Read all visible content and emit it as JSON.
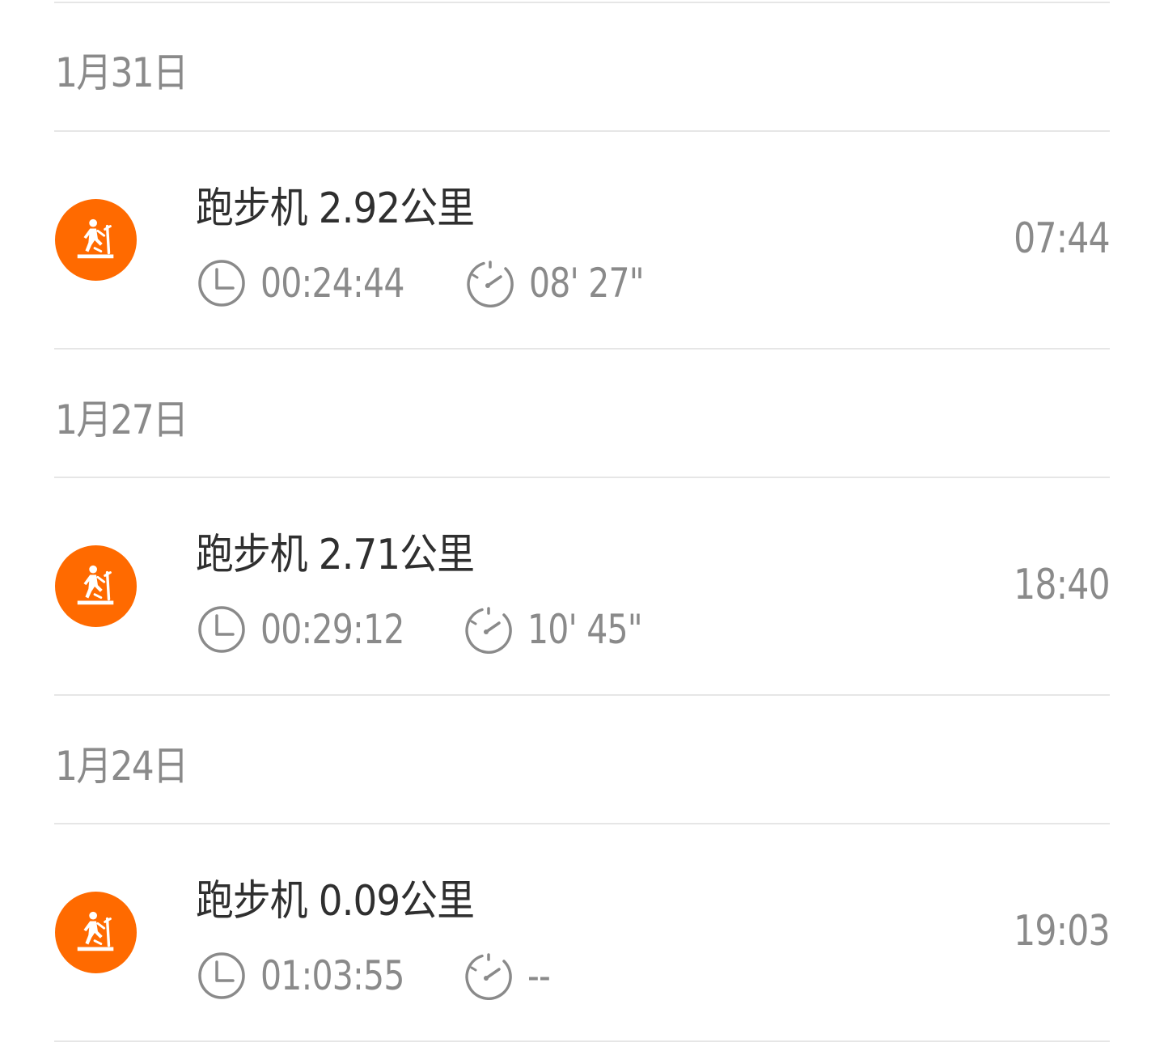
{
  "accent_color": "#ff6a00",
  "groups": [
    {
      "date": "1月31日",
      "entries": [
        {
          "icon": "treadmill-icon",
          "activity": "跑步机",
          "distance": "2.92公里",
          "duration_icon": "clock-icon",
          "duration": "00:24:44",
          "pace_icon": "speedometer-icon",
          "pace": "08' 27\"",
          "time": "07:44"
        }
      ]
    },
    {
      "date": "1月27日",
      "entries": [
        {
          "icon": "treadmill-icon",
          "activity": "跑步机",
          "distance": "2.71公里",
          "duration_icon": "clock-icon",
          "duration": "00:29:12",
          "pace_icon": "speedometer-icon",
          "pace": "10' 45\"",
          "time": "18:40"
        }
      ]
    },
    {
      "date": "1月24日",
      "entries": [
        {
          "icon": "treadmill-icon",
          "activity": "跑步机",
          "distance": "0.09公里",
          "duration_icon": "clock-icon",
          "duration": "01:03:55",
          "pace_icon": "speedometer-icon",
          "pace": "--",
          "time": "19:03"
        }
      ]
    }
  ]
}
